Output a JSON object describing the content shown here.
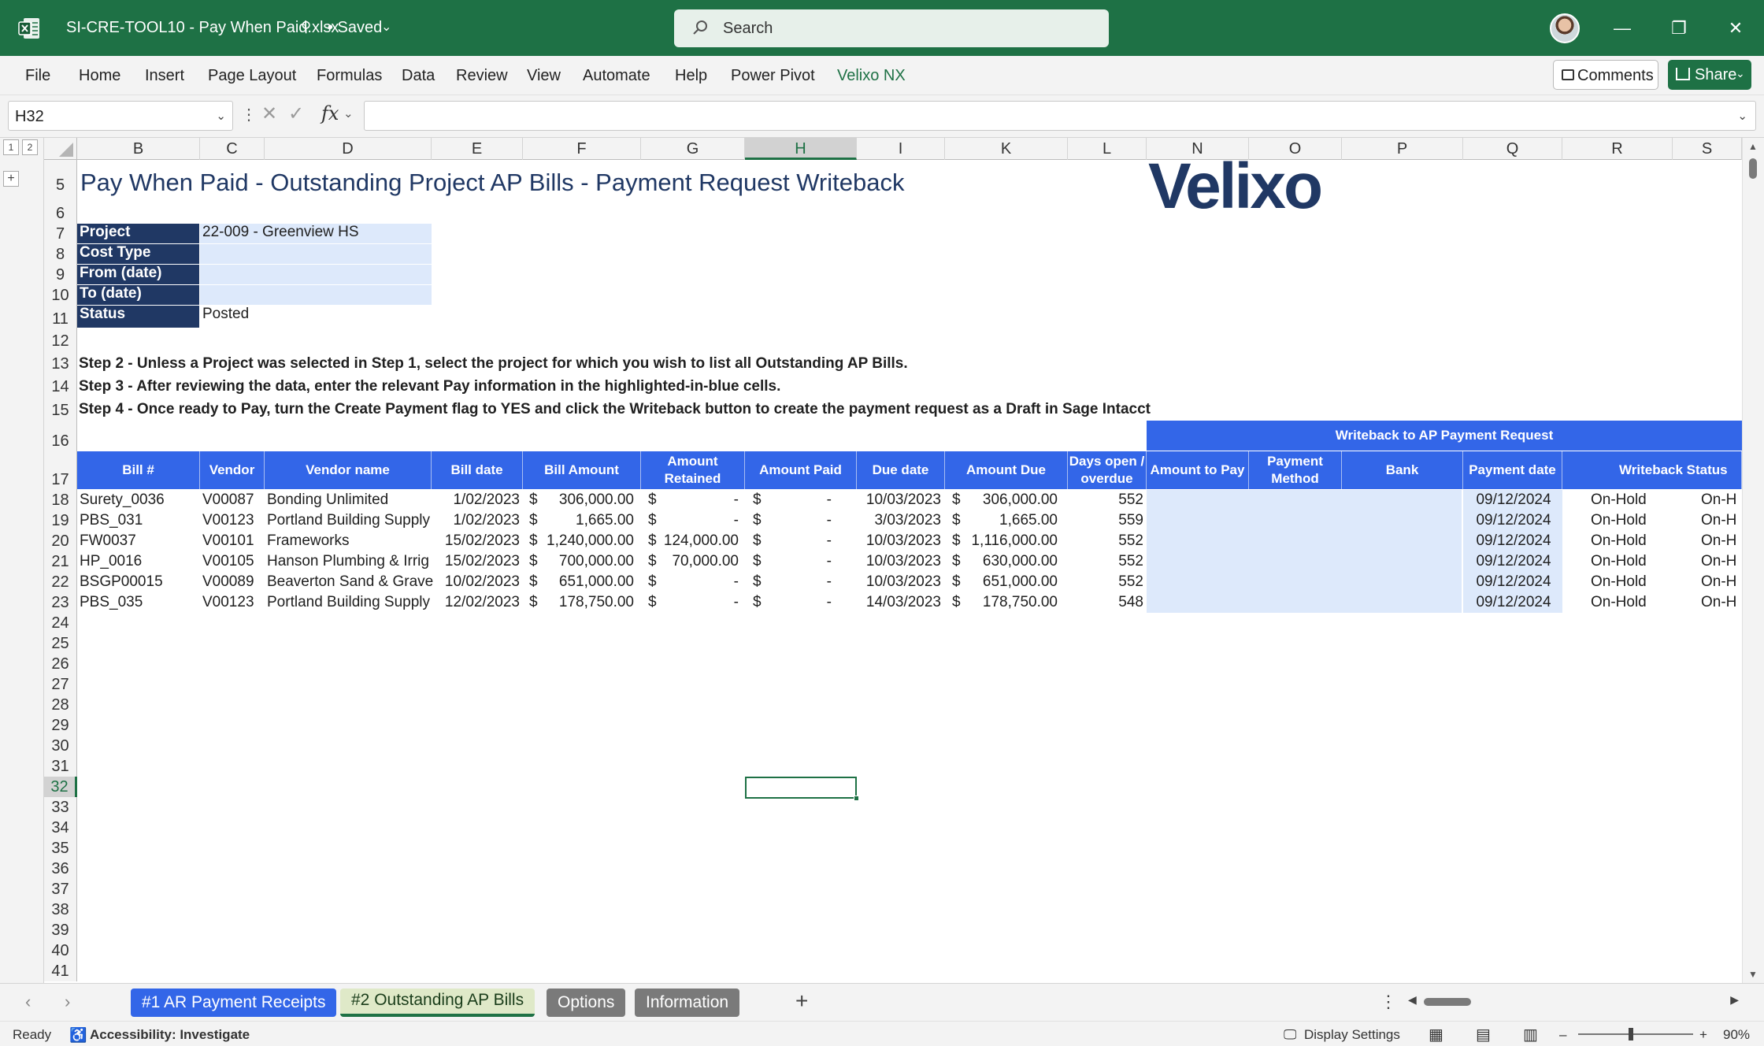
{
  "app": {
    "doc_title": "SI-CRE-TOOL10 - Pay When Paid.xlsx",
    "saved_status": "• Saved",
    "search_placeholder": "Search"
  },
  "ribbon": {
    "tabs": [
      "File",
      "Home",
      "Insert",
      "Page Layout",
      "Formulas",
      "Data",
      "Review",
      "View",
      "Automate",
      "Help",
      "Power Pivot",
      "Velixo NX"
    ],
    "comments_label": "Comments",
    "share_label": "Share"
  },
  "formula_bar": {
    "name_box": "H32",
    "formula": ""
  },
  "columns": [
    "B",
    "C",
    "D",
    "E",
    "F",
    "G",
    "H",
    "I",
    "K",
    "L",
    "N",
    "O",
    "P",
    "Q",
    "R",
    "S"
  ],
  "rows": [
    "5",
    "6",
    "7",
    "8",
    "9",
    "10",
    "11",
    "12",
    "13",
    "14",
    "15",
    "16",
    "17",
    "18",
    "19",
    "20",
    "21",
    "22",
    "23",
    "24",
    "25",
    "26",
    "27",
    "28",
    "29",
    "30",
    "31",
    "32",
    "33",
    "34",
    "35",
    "36",
    "37",
    "38",
    "39",
    "40",
    "41"
  ],
  "sheet": {
    "title": "Pay When Paid - Outstanding Project AP Bills - Payment Request Writeback",
    "logo_text": "Velixo",
    "params": [
      {
        "label": "Project",
        "value": "22-009 - Greenview HS"
      },
      {
        "label": "Cost Type",
        "value": ""
      },
      {
        "label": "From (date)",
        "value": ""
      },
      {
        "label": "To (date)",
        "value": ""
      },
      {
        "label": "Status",
        "value": "Posted"
      }
    ],
    "steps": [
      "Step 2 - Unless a Project was selected in Step 1, select the project for which you wish to list all Outstanding AP Bills.",
      "Step 3 - After reviewing the data, enter the relevant Pay information in the highlighted-in-blue cells.",
      "Step 4 - Once ready to Pay, turn the Create Payment flag to YES and click the Writeback button to create the payment request as a Draft in Sage Intacct"
    ],
    "writeback_band": "Writeback to AP Payment Request",
    "headers": [
      "Bill #",
      "Vendor",
      "Vendor name",
      "Bill date",
      "Bill Amount",
      "Amount Retained",
      "Amount Paid",
      "Due date",
      "Amount Due",
      "Days open / overdue",
      "Amount to Pay",
      "Payment Method",
      "Bank",
      "Payment date",
      "Writeback Status"
    ],
    "bills": [
      {
        "bill": "Surety_0036",
        "vendor": "V00087",
        "name": "Bonding Unlimited",
        "date": "1/02/2023",
        "amount": "306,000.00",
        "retained": "-",
        "paid": "-",
        "due": "10/03/2023",
        "amount_due": "306,000.00",
        "days": "552",
        "pay_date": "09/12/2024",
        "status": "On-Hold",
        "status2": "On-H"
      },
      {
        "bill": "PBS_031",
        "vendor": "V00123",
        "name": "Portland Building Supply",
        "date": "1/02/2023",
        "amount": "1,665.00",
        "retained": "-",
        "paid": "-",
        "due": "3/03/2023",
        "amount_due": "1,665.00",
        "days": "559",
        "pay_date": "09/12/2024",
        "status": "On-Hold",
        "status2": "On-H"
      },
      {
        "bill": "FW0037",
        "vendor": "V00101",
        "name": "Frameworks",
        "date": "15/02/2023",
        "amount": "1,240,000.00",
        "retained": "124,000.00",
        "paid": "-",
        "due": "10/03/2023",
        "amount_due": "1,116,000.00",
        "days": "552",
        "pay_date": "09/12/2024",
        "status": "On-Hold",
        "status2": "On-H"
      },
      {
        "bill": "HP_0016",
        "vendor": "V00105",
        "name": "Hanson Plumbing & Irrig",
        "date": "15/02/2023",
        "amount": "700,000.00",
        "retained": "70,000.00",
        "paid": "-",
        "due": "10/03/2023",
        "amount_due": "630,000.00",
        "days": "552",
        "pay_date": "09/12/2024",
        "status": "On-Hold",
        "status2": "On-H"
      },
      {
        "bill": "BSGP00015",
        "vendor": "V00089",
        "name": "Beaverton Sand & Grave",
        "date": "10/02/2023",
        "amount": "651,000.00",
        "retained": "-",
        "paid": "-",
        "due": "10/03/2023",
        "amount_due": "651,000.00",
        "days": "552",
        "pay_date": "09/12/2024",
        "status": "On-Hold",
        "status2": "On-H"
      },
      {
        "bill": "PBS_035",
        "vendor": "V00123",
        "name": "Portland Building Supply",
        "date": "12/02/2023",
        "amount": "178,750.00",
        "retained": "-",
        "paid": "-",
        "due": "14/03/2023",
        "amount_due": "178,750.00",
        "days": "548",
        "pay_date": "09/12/2024",
        "status": "On-Hold",
        "status2": "On-H"
      }
    ],
    "currency": "$"
  },
  "sheet_tabs": [
    "#1 AR Payment Receipts",
    "#2 Outstanding AP Bills",
    "Options",
    "Information"
  ],
  "status": {
    "ready": "Ready",
    "accessibility": "Accessibility: Investigate",
    "display_settings": "Display Settings",
    "zoom": "90%"
  },
  "colors": {
    "excel_green": "#1e7145",
    "header_blue": "#3366e8",
    "label_navy": "#203864",
    "input_blue": "#dde9fb"
  }
}
